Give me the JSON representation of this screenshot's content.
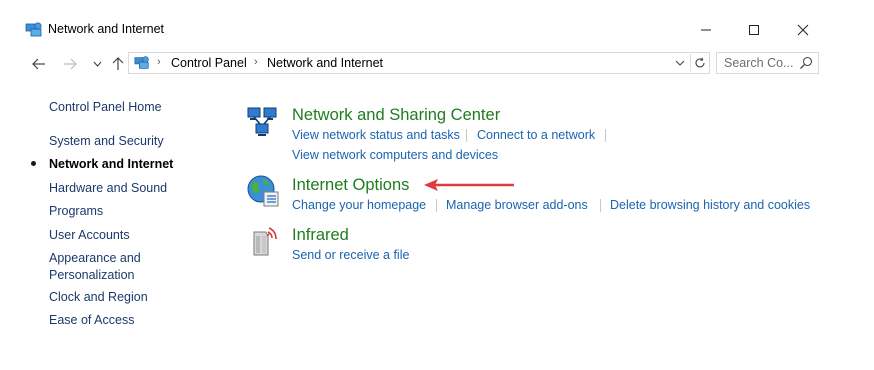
{
  "window": {
    "title": "Network and Internet",
    "icon": "network-globe-icon"
  },
  "navigation": {
    "back_icon": "back-arrow-icon",
    "forward_icon": "forward-arrow-icon",
    "recent_icon": "chevron-down-icon",
    "up_icon": "up-arrow-icon"
  },
  "address": {
    "segments": [
      "Control Panel",
      "Network and Internet"
    ]
  },
  "search": {
    "placeholder": "Search Co..."
  },
  "sidebar": {
    "home": "Control Panel Home",
    "items": [
      {
        "label": "System and Security",
        "active": false
      },
      {
        "label": "Network and Internet",
        "active": true
      },
      {
        "label": "Hardware and Sound",
        "active": false
      },
      {
        "label": "Programs",
        "active": false
      },
      {
        "label": "User Accounts",
        "active": false
      },
      {
        "label": "Appearance and",
        "label2": "Personalization",
        "active": false
      },
      {
        "label": "Clock and Region",
        "active": false
      },
      {
        "label": "Ease of Access",
        "active": false
      }
    ]
  },
  "categories": [
    {
      "title": "Network and Sharing Center",
      "icon": "network-sharing-icon",
      "tasks": [
        "View network status and tasks",
        "Connect to a network",
        "View network computers and devices"
      ]
    },
    {
      "title": "Internet Options",
      "icon": "internet-options-icon",
      "tasks": [
        "Change your homepage",
        "Manage browser add-ons",
        "Delete browsing history and cookies"
      ]
    },
    {
      "title": "Infrared",
      "icon": "infrared-icon",
      "tasks": [
        "Send or receive a file"
      ]
    }
  ],
  "annotation": {
    "arrow_color": "#e03a3e"
  },
  "colors": {
    "category_title": "#1e7d1e",
    "task_link": "#1a64b0",
    "sidebar_link": "#1a3a6b"
  }
}
